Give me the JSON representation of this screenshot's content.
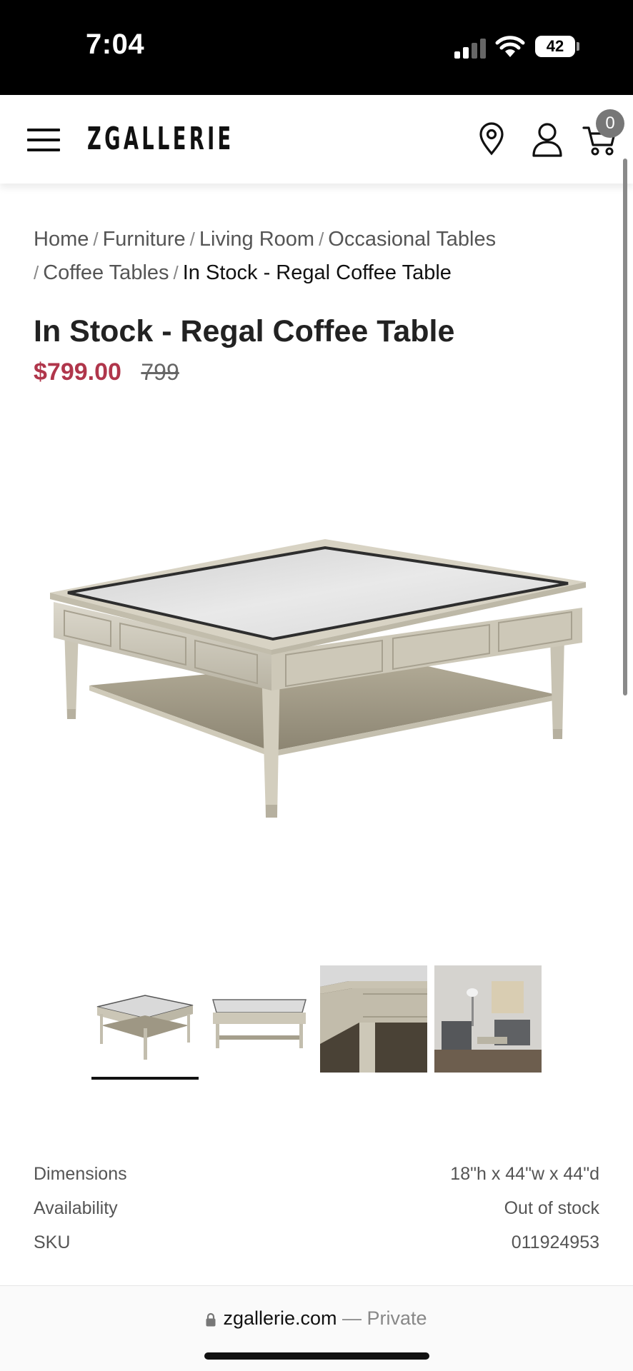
{
  "status_bar": {
    "time": "7:04",
    "battery": "42"
  },
  "header": {
    "logo": "ZGALLERIE",
    "cart_count": "0"
  },
  "breadcrumb": {
    "items": [
      "Home",
      "Furniture",
      "Living Room",
      "Occasional Tables",
      "Coffee Tables"
    ],
    "current": "In Stock - Regal Coffee Table",
    "separator": "/"
  },
  "product": {
    "title": "In Stock - Regal Coffee Table",
    "price_sale": "$799.00",
    "price_original": "799",
    "thumbnails": [
      "table-front",
      "table-side",
      "table-corner-detail",
      "living-room-scene"
    ],
    "selected_thumbnail": 0
  },
  "specs": [
    {
      "label": "Dimensions",
      "value": "18\"h x 44\"w x 44\"d"
    },
    {
      "label": "Availability",
      "value": "Out of stock"
    },
    {
      "label": "SKU",
      "value": "011924953"
    }
  ],
  "browser": {
    "domain": "zgallerie.com",
    "suffix": "— Private"
  },
  "colors": {
    "sale_price": "#b0364b",
    "status_bar": "#000000"
  }
}
